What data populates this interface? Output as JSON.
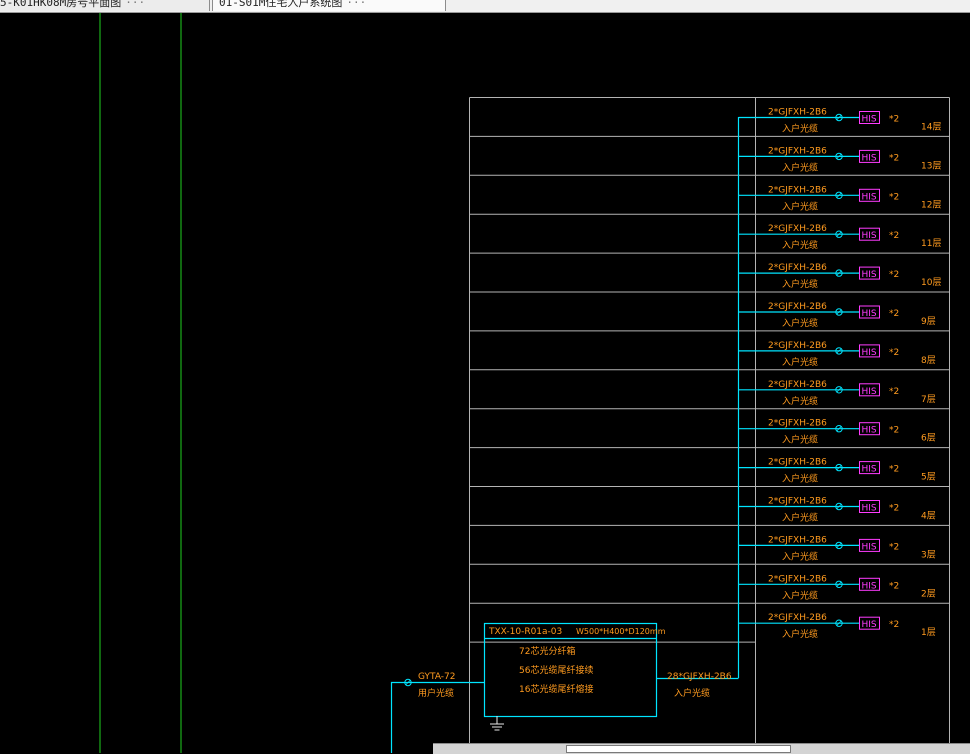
{
  "tabs": [
    {
      "label": "5-K01HK08M房号平面图",
      "active": false
    },
    {
      "label": "01-S01M住宅入户系统图",
      "active": true
    }
  ],
  "tab_overflow": "···",
  "colors": {
    "cyan": "#00e5ff",
    "orange": "#ff9b1f",
    "magenta": "#ff3cff",
    "frame": "#b4b4b4",
    "guide_green": "#1fd11f"
  },
  "floors": [
    {
      "cable": "2*GJFXH-2B6",
      "desc": "入户光缆",
      "terminal": "HIS",
      "count": "*2",
      "floor": "14层"
    },
    {
      "cable": "2*GJFXH-2B6",
      "desc": "入户光缆",
      "terminal": "HIS",
      "count": "*2",
      "floor": "13层"
    },
    {
      "cable": "2*GJFXH-2B6",
      "desc": "入户光缆",
      "terminal": "HIS",
      "count": "*2",
      "floor": "12层"
    },
    {
      "cable": "2*GJFXH-2B6",
      "desc": "入户光缆",
      "terminal": "HIS",
      "count": "*2",
      "floor": "11层"
    },
    {
      "cable": "2*GJFXH-2B6",
      "desc": "入户光缆",
      "terminal": "HIS",
      "count": "*2",
      "floor": "10层"
    },
    {
      "cable": "2*GJFXH-2B6",
      "desc": "入户光缆",
      "terminal": "HIS",
      "count": "*2",
      "floor": "9层"
    },
    {
      "cable": "2*GJFXH-2B6",
      "desc": "入户光缆",
      "terminal": "HIS",
      "count": "*2",
      "floor": "8层"
    },
    {
      "cable": "2*GJFXH-2B6",
      "desc": "入户光缆",
      "terminal": "HIS",
      "count": "*2",
      "floor": "7层"
    },
    {
      "cable": "2*GJFXH-2B6",
      "desc": "入户光缆",
      "terminal": "HIS",
      "count": "*2",
      "floor": "6层"
    },
    {
      "cable": "2*GJFXH-2B6",
      "desc": "入户光缆",
      "terminal": "HIS",
      "count": "*2",
      "floor": "5层"
    },
    {
      "cable": "2*GJFXH-2B6",
      "desc": "入户光缆",
      "terminal": "HIS",
      "count": "*2",
      "floor": "4层"
    },
    {
      "cable": "2*GJFXH-2B6",
      "desc": "入户光缆",
      "terminal": "HIS",
      "count": "*2",
      "floor": "3层"
    },
    {
      "cable": "2*GJFXH-2B6",
      "desc": "入户光缆",
      "terminal": "HIS",
      "count": "*2",
      "floor": "2层"
    },
    {
      "cable": "2*GJFXH-2B6",
      "desc": "入户光缆",
      "terminal": "HIS",
      "count": "*2",
      "floor": "1层"
    }
  ],
  "box": {
    "id": "TXX-10-R01a-03",
    "size": "W500*H400*D120mm",
    "lines": [
      "72芯光分纤箱",
      "56芯光缆尾纤接续",
      "16芯光缆尾纤熔接"
    ]
  },
  "trunk": {
    "cable": "28*GJFXH-2B6",
    "desc": "入户光缆"
  },
  "incoming": {
    "cable": "GYTA-72",
    "desc": "用户光缆"
  }
}
